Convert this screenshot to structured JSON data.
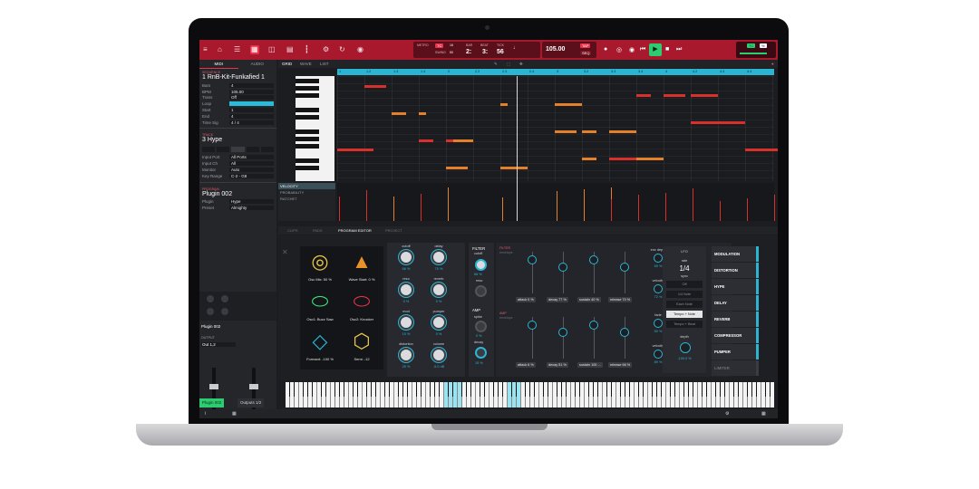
{
  "topbar": {
    "metro_label": "METRO",
    "metro_value": "TC",
    "metro_number": "16",
    "swing_label": "SWING",
    "swing_value": "50",
    "bar_label": "BAR",
    "beat_label": "BEAT",
    "tick_label": "TICK",
    "bar_value": "2:",
    "beat_value": "3:",
    "tick_value": "56",
    "bpm_value": "105.00",
    "tap_label": "TAP",
    "seq_label": "SEQ",
    "zoom_tc": "TC",
    "zoom_pct": "%"
  },
  "left": {
    "tab_midi": "MIDI",
    "tab_audio": "AUDIO",
    "sequence_header": "SEQUENCE",
    "sequence_name": "1 RnB-Kit-Funkafied 1",
    "seq_rows": [
      {
        "k": "Bars",
        "v": "4"
      },
      {
        "k": "BPM",
        "v": "105.00"
      },
      {
        "k": "Trans",
        "v": "Off"
      },
      {
        "k": "Loop",
        "v": ""
      },
      {
        "k": "Start",
        "v": "1"
      },
      {
        "k": "End",
        "v": "4"
      },
      {
        "k": "Time Sig",
        "v": "4 / 4"
      }
    ],
    "track_header": "TRACK",
    "track_name": "3 Hype",
    "track_rows": [
      {
        "k": "Input Port",
        "v": "All Ports"
      },
      {
        "k": "Input Ch",
        "v": "All"
      },
      {
        "k": "Monitor",
        "v": "Auto"
      },
      {
        "k": "Key Range",
        "v": "C-2 - G8"
      }
    ],
    "program_header": "PROGRAM",
    "program_name": "Plugin 002",
    "program_rows": [
      {
        "k": "Plugin",
        "v": "Hype"
      },
      {
        "k": "Preset",
        "v": "Almighty"
      }
    ],
    "mixer_name": "Plugin 002",
    "output_label": "OUTPUT",
    "output_value": "Out 1,2",
    "tab_plugin": "Plugin 002",
    "tab_outputs": "Outputs 1/2"
  },
  "pianoroll": {
    "tab_grid": "GRID",
    "tab_wave": "WAVE",
    "tab_list": "LIST",
    "ruler": [
      "1",
      "1.2",
      "1.3",
      "1.4",
      "2",
      "2.2",
      "2.3",
      "2.4",
      "3",
      "3.2",
      "3.3",
      "3.4",
      "4",
      "4.2",
      "4.3",
      "4.4"
    ],
    "lanes": [
      "VELOCITY",
      "PROBABILITY",
      "RATCHET"
    ]
  },
  "editor": {
    "tabs": [
      "CLIPS",
      "PADS",
      "PROGRAM EDITOR",
      "PROJECT"
    ],
    "xy": [
      {
        "label": "Osc Mix: 50 %"
      },
      {
        "label": "Wave Start: 0 %"
      },
      {
        "label": "Osc1: Buzz Saw"
      },
      {
        "label": "Osc2: Knocker"
      },
      {
        "label": "Formant: -100 %"
      },
      {
        "label": "Semi: -12"
      }
    ],
    "knobs": [
      {
        "label": "cutoff",
        "value": "66 %"
      },
      {
        "label": "delay",
        "value": "75 %"
      },
      {
        "label": "reso",
        "value": "0 %"
      },
      {
        "label": "reverb",
        "value": "0 %"
      },
      {
        "label": "mod",
        "value": "15 %"
      },
      {
        "label": "pumper",
        "value": "0 %"
      },
      {
        "label": "distortion",
        "value": "25 %"
      },
      {
        "label": "volume",
        "value": "-5.0 dB"
      }
    ],
    "filter_header": "FILTER",
    "filter_cutoff_label": "cutoff",
    "filter_cutoff_value": "66 %",
    "filter_reso_label": "reso",
    "amp_header": "AMP",
    "amp_spike_label": "spike",
    "amp_spike_value": "0 %",
    "amp_decay_label": "decay",
    "amp_decay_value": "15 %",
    "filter_env_header": "FILTER",
    "amp_env_header": "AMP",
    "env_sub": "envelope",
    "filter_env": [
      {
        "label": "attack",
        "value": "0 %"
      },
      {
        "label": "decay",
        "value": "77 %"
      },
      {
        "label": "sustain",
        "value": "40 %"
      },
      {
        "label": "release",
        "value": "70 %"
      }
    ],
    "amp_env": [
      {
        "label": "attack",
        "value": "6 %"
      },
      {
        "label": "decay",
        "value": "51 %"
      },
      {
        "label": "sustain",
        "value": "100 ..."
      },
      {
        "label": "release",
        "value": "66 %"
      }
    ],
    "env_depth_label": "env depth",
    "env_depth_value": "65 %",
    "velocity1_label": "velocity",
    "velocity1_value": "72 %",
    "fade_label": "fade",
    "fade_value": "50 %",
    "velocity2_label": "velocity",
    "velocity2_value": "89 %",
    "lfo": {
      "title": "LFO",
      "rate_label": "rate",
      "rate_value": "1/4",
      "sync_label": "sync",
      "opts": [
        "Off",
        "1/4 Note",
        "Each Note",
        "Tempo + Note",
        "Tempo + Beat"
      ],
      "depth_label": "depth",
      "depth_value": "-100.0 %"
    },
    "fx": [
      "MODULATION",
      "DISTORTION",
      "HYPE",
      "DELAY",
      "REVERB",
      "COMPRESSOR",
      "PUMPER",
      "LIMITER"
    ]
  },
  "colors": {
    "brand_red": "#a8192e",
    "accent_cyan": "#2bb5d3",
    "note_orange": "#e5802a",
    "note_red": "#d8312b",
    "play_green": "#2ecc71"
  }
}
